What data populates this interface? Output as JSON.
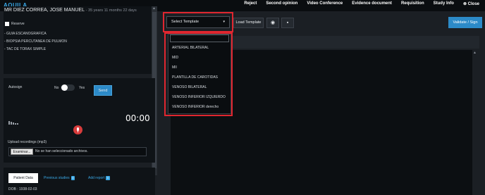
{
  "topbar": {
    "logo": "AQUILA",
    "nav": [
      "Reject",
      "Second opinion",
      "Video Conference",
      "Evidence document",
      "Requisition",
      "Study Info",
      "Close"
    ],
    "close_icon": "close-circle-icon"
  },
  "patient": {
    "name": "MR DIEZ CORREA, JOSE MANUEL",
    "age": "- 35 years 11 months 22 days",
    "reserve_label": "Reserve",
    "reserve_checked": false,
    "procedures": [
      "- GUIA ESCANOGRAFICA",
      "- BIOPSIA PERCUTANEA DE PULMON",
      "- TAC DE TORAX SIMPLE"
    ]
  },
  "dictation": {
    "autosign_label": "Autosign",
    "no_label": "No",
    "yes_label": "Yes",
    "autosign_on": false,
    "send_label": "Send",
    "timer": "00:00",
    "mic_icon": "microphone-icon",
    "upload_label": "Upload recordings (mp3)",
    "file_button": "Examinar...",
    "file_text": "No se han seleccionado archivos."
  },
  "tabs": {
    "patient_data": "Patient Data",
    "previous_studies": "Previous studies",
    "previous_studies_count": "0",
    "add_report": "Add report",
    "add_report_count": "0"
  },
  "patient_data": {
    "dob": "DOB : 1938-02-03"
  },
  "toolbar": {
    "select_placeholder": "Select Template",
    "load_template": "Load Template",
    "eye_icon": "eye-icon",
    "save_icon": "save-icon",
    "validate_sign": "Validate / Sign"
  },
  "template_dropdown": {
    "search_value": "",
    "options": [
      "ARTERIAL BILATERAL",
      "MID",
      "MII",
      "PLANTILLA DE CAROTIDAS",
      "VENOSO BILATERAL",
      "VENOSO INFERIOR IZQUIERDO",
      "VENOSO INFERIOR derecho"
    ]
  },
  "colors": {
    "accent": "#2c8ac8",
    "highlight": "#e0262f",
    "mic": "#d83c3c"
  }
}
